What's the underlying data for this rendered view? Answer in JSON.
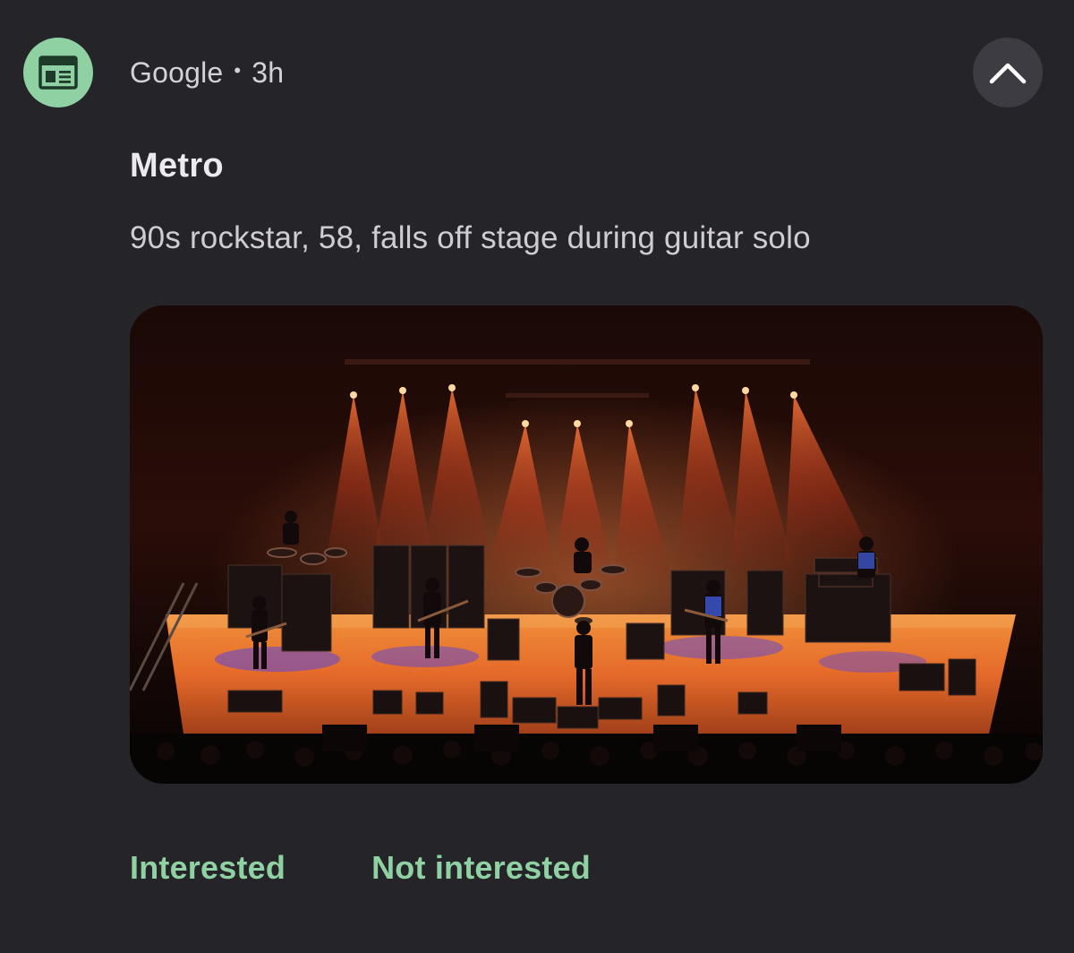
{
  "notification": {
    "app_name": "Google",
    "separator": "•",
    "time": "3h",
    "title": "Metro",
    "body": "90s rockstar, 58, falls off stage during guitar solo",
    "icons": {
      "app": "news-icon",
      "collapse": "chevron-up-icon"
    },
    "colors": {
      "background": "#252429",
      "accent": "#8fd1a3",
      "collapse_button": "#3d3c42"
    },
    "actions": {
      "interested_label": "Interested",
      "not_interested_label": "Not interested"
    }
  }
}
